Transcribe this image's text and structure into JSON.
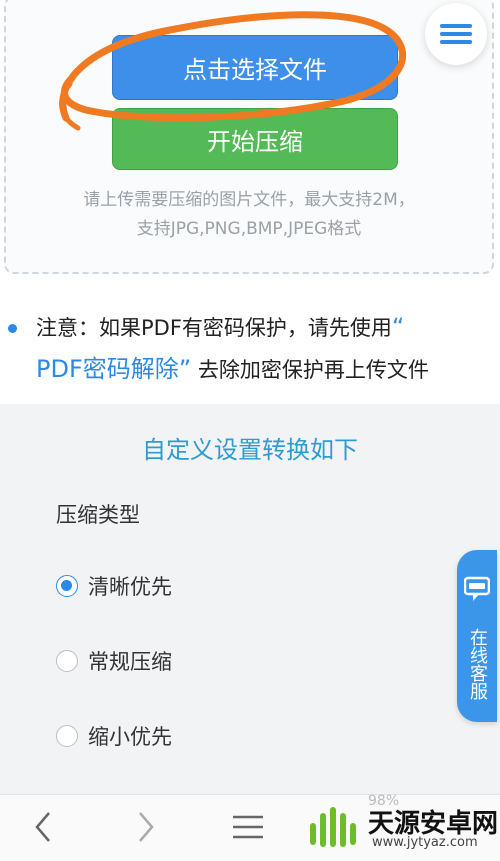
{
  "upload": {
    "select_file_label": "点击选择文件",
    "start_compress_label": "开始压缩",
    "hint_line1": "请上传需要压缩的图片文件，最大支持2M，",
    "hint_line2": "支持JPG,PNG,BMP,JPEG格式"
  },
  "notice": {
    "prefix": "注意：如果PDF有密码保护，请先使用",
    "open_quote": "“",
    "link_text": "PDF密码解除",
    "close_quote": "”",
    "suffix": "去除加密保护再上传文件"
  },
  "settings": {
    "title": "自定义设置转换如下",
    "compress_type_label": "压缩类型",
    "options": [
      {
        "label": "清晰优先",
        "selected": true
      },
      {
        "label": "常规压缩",
        "selected": false
      },
      {
        "label": "缩小优先",
        "selected": false
      }
    ]
  },
  "chat": {
    "label": "在线客服"
  },
  "bottom_nav": {
    "badge": "98%"
  },
  "watermark": {
    "title": "天源安卓网",
    "url": "www.jytyaz.com"
  },
  "colors": {
    "primary": "#3d8fe9",
    "success": "#54b957",
    "accent": "#2a8ae5",
    "annotation": "#f07a22"
  }
}
